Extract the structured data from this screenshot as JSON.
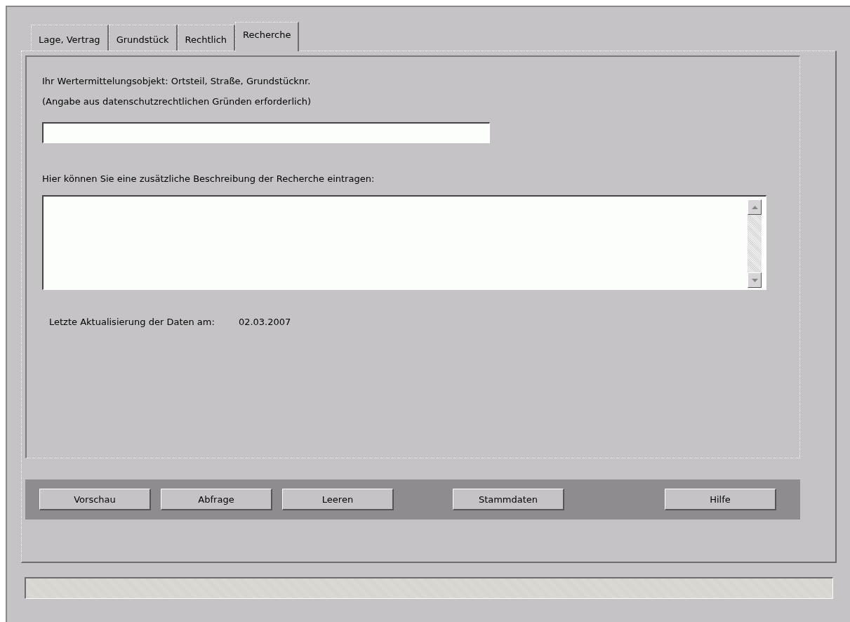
{
  "tabs": [
    {
      "label": "Lage, Vertrag",
      "selected": false
    },
    {
      "label": "Grundstück",
      "selected": false
    },
    {
      "label": "Rechtlich",
      "selected": false
    },
    {
      "label": "Recherche",
      "selected": true
    }
  ],
  "object_label": "Ihr Wertermittelungsobjekt: Ortsteil, Straße, Grundstücknr.",
  "object_hint": "(Angabe aus datenschutzrechtlichen Gründen erforderlich)",
  "description_label": "Hier können Sie eine zusätzliche Beschreibung der Recherche eintragen:",
  "update_label": "Letzte Aktualisierung der Daten am:",
  "update_date": "02.03.2007",
  "button_groups": [
    [
      "Vorschau",
      "Abfrage",
      "Leeren"
    ],
    [
      "Stammdaten"
    ],
    [
      "Hilfe"
    ]
  ]
}
